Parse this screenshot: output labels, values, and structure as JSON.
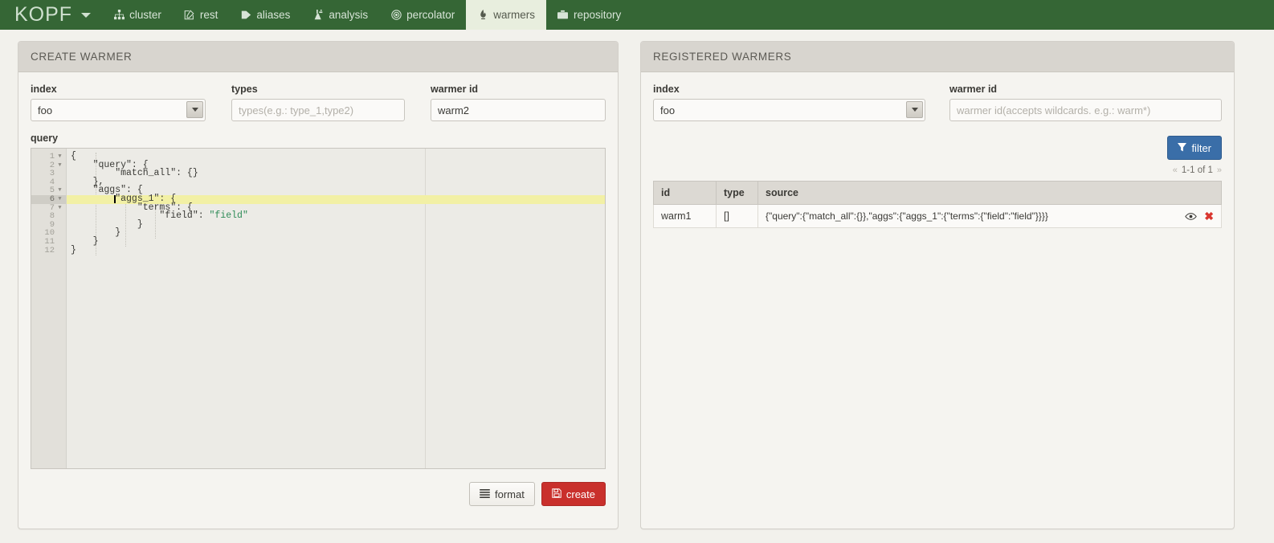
{
  "navbar": {
    "brand": "KOPF",
    "brand_caret_icon": "chevron-down-icon",
    "items": [
      {
        "label": "cluster",
        "icon": "sitemap-icon",
        "active": false
      },
      {
        "label": "rest",
        "icon": "edit-icon",
        "active": false
      },
      {
        "label": "aliases",
        "icon": "tag-icon",
        "active": false
      },
      {
        "label": "analysis",
        "icon": "flask-icon",
        "active": false
      },
      {
        "label": "percolator",
        "icon": "bullseye-icon",
        "active": false
      },
      {
        "label": "warmers",
        "icon": "fire-icon",
        "active": true
      },
      {
        "label": "repository",
        "icon": "briefcase-icon",
        "active": false
      }
    ]
  },
  "create_warmer": {
    "title": "CREATE WARMER",
    "index": {
      "label": "index",
      "value": "foo"
    },
    "types": {
      "label": "types",
      "value": "",
      "placeholder": "types(e.g.: type_1,type2)"
    },
    "warmer_id": {
      "label": "warmer id",
      "value": "warm2",
      "placeholder": ""
    },
    "query": {
      "label": "query",
      "lines": [
        {
          "n": "1",
          "text": "{",
          "fold": true
        },
        {
          "n": "2",
          "text": "    \"query\": {",
          "fold": true
        },
        {
          "n": "3",
          "text": "        \"match_all\": {}",
          "fold": false
        },
        {
          "n": "4",
          "text": "    },",
          "fold": false
        },
        {
          "n": "5",
          "text": "    \"aggs\": {",
          "fold": true
        },
        {
          "n": "6",
          "text": "        \"aggs_1\": {",
          "fold": true
        },
        {
          "n": "7",
          "text": "            \"terms\": {",
          "fold": true
        },
        {
          "n": "8",
          "text": "                \"field\": ",
          "fold": false,
          "string_tail": "\"field\""
        },
        {
          "n": "9",
          "text": "            }",
          "fold": false
        },
        {
          "n": "10",
          "text": "        }",
          "fold": false
        },
        {
          "n": "11",
          "text": "    }",
          "fold": false
        },
        {
          "n": "12",
          "text": "}",
          "fold": false
        }
      ],
      "active_line": 6
    },
    "format_button": {
      "label": "format",
      "icon": "align-justify-icon"
    },
    "create_button": {
      "label": "create",
      "icon": "save-icon"
    }
  },
  "registered_warmers": {
    "title": "REGISTERED WARMERS",
    "index": {
      "label": "index",
      "value": "foo"
    },
    "warmer_id": {
      "label": "warmer id",
      "value": "",
      "placeholder": "warmer id(accepts wildcards. e.g.: warm*)"
    },
    "filter_button": {
      "label": "filter",
      "icon": "filter-icon"
    },
    "pager": {
      "prev_icon": "«",
      "next_icon": "»",
      "text": "1-1 of 1"
    },
    "table": {
      "headers": [
        "id",
        "type",
        "source"
      ],
      "rows": [
        {
          "id": "warm1",
          "type": "[]",
          "source": "{\"query\":{\"match_all\":{}},\"aggs\":{\"aggs_1\":{\"terms\":{\"field\":\"field\"}}}}",
          "view_icon": "eye-icon",
          "delete_icon": "close-icon"
        }
      ]
    }
  },
  "colors": {
    "navbar_bg": "#356635",
    "active_tab_bg": "#e8eede",
    "page_bg": "#f2f1ec",
    "panel_head_bg": "#d8d5cf",
    "primary": "#3a6ea8",
    "danger": "#c9302c",
    "delete_icon": "#d9362f",
    "string_token": "#2e8b57",
    "active_line": "#f2f0a5"
  }
}
